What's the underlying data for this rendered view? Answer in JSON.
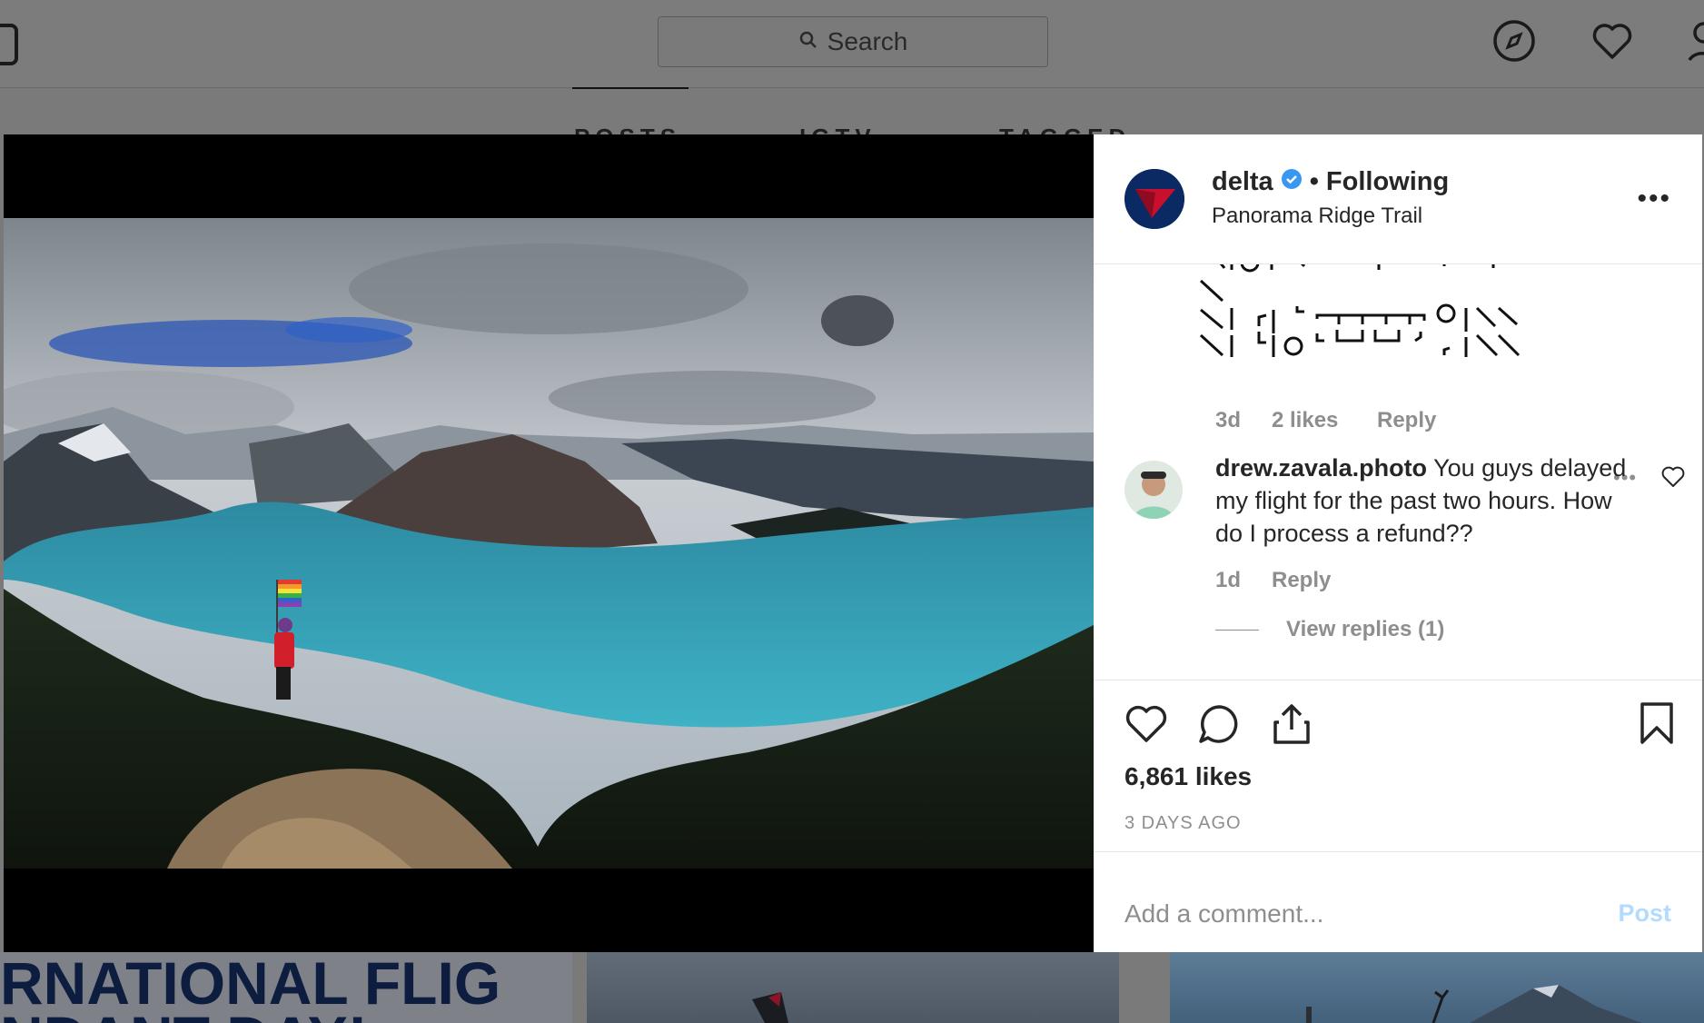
{
  "search": {
    "placeholder": "Search"
  },
  "profile_tabs": [
    "POSTS",
    "IGTV",
    "TAGGED"
  ],
  "post": {
    "username": "delta",
    "following": "• Following",
    "location": "Panorama Ridge Trail",
    "likes": "6,861 likes",
    "date": "3 DAYS AGO"
  },
  "comments": [
    {
      "time": "3d",
      "likes": "2 likes",
      "reply": "Reply"
    },
    {
      "user": "drew.zavala.photo",
      "text": "You guys delayed my flight for the past two hours. How do I process a refund??",
      "time": "1d",
      "reply": "Reply",
      "view_replies": "View replies (1)"
    }
  ],
  "add_comment": {
    "placeholder": "Add a comment...",
    "post": "Post"
  },
  "grid_banner": "RNATIONAL FLIG",
  "grid_banner2": "NDANT DAY!",
  "colors": {
    "verified": "#3897f0",
    "post_button": "#b3dbff",
    "delta_red": "#c8102e",
    "delta_blue": "#0b2a63"
  }
}
